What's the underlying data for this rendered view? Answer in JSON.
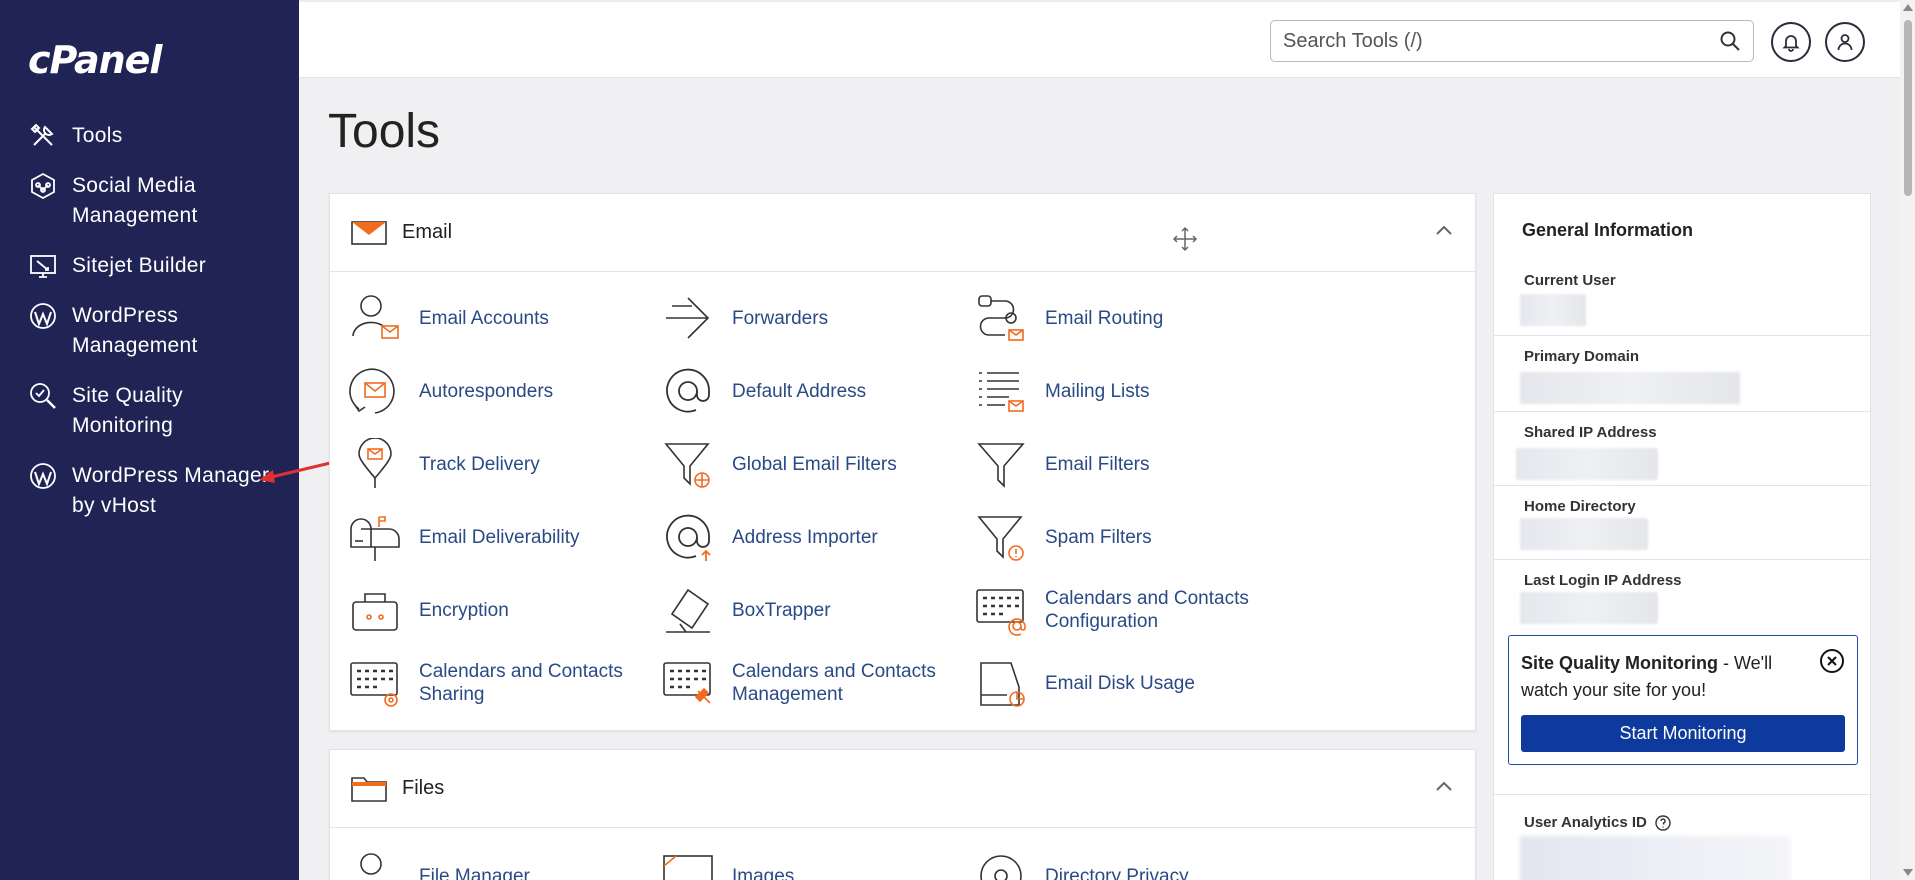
{
  "sidebar": {
    "logo": "cPanel",
    "items": [
      {
        "label": "Tools",
        "icon": "tools-icon"
      },
      {
        "label": "Social Media Management",
        "icon": "social-media-icon"
      },
      {
        "label": "Sitejet Builder",
        "icon": "sitejet-icon"
      },
      {
        "label": "WordPress Management",
        "icon": "wordpress-icon"
      },
      {
        "label": "Site Quality Monitoring",
        "icon": "site-quality-icon"
      },
      {
        "label": "WordPress Manager by vHost",
        "icon": "wordpress-icon"
      }
    ]
  },
  "topbar": {
    "search_placeholder": "Search Tools (/)"
  },
  "main": {
    "page_title": "Tools",
    "email": {
      "title": "Email",
      "tools": [
        {
          "label": "Email Accounts",
          "icon": "email-accounts-icon"
        },
        {
          "label": "Forwarders",
          "icon": "forwarders-icon"
        },
        {
          "label": "Email Routing",
          "icon": "email-routing-icon"
        },
        {
          "label": "Autoresponders",
          "icon": "autoresponders-icon"
        },
        {
          "label": "Default Address",
          "icon": "default-address-icon"
        },
        {
          "label": "Mailing Lists",
          "icon": "mailing-lists-icon"
        },
        {
          "label": "Track Delivery",
          "icon": "track-delivery-icon"
        },
        {
          "label": "Global Email Filters",
          "icon": "global-filters-icon"
        },
        {
          "label": "Email Filters",
          "icon": "email-filters-icon"
        },
        {
          "label": "Email Deliverability",
          "icon": "mailbox-icon"
        },
        {
          "label": "Address Importer",
          "icon": "address-importer-icon"
        },
        {
          "label": "Spam Filters",
          "icon": "spam-filters-icon"
        },
        {
          "label": "Encryption",
          "icon": "encryption-icon"
        },
        {
          "label": "BoxTrapper",
          "icon": "boxtrapper-icon"
        },
        {
          "label": "Calendars and Contacts Configuration",
          "icon": "calendar-config-icon"
        },
        {
          "label": "Calendars and Contacts Sharing",
          "icon": "calendar-sharing-icon"
        },
        {
          "label": "Calendars and Contacts Management",
          "icon": "calendar-management-icon"
        },
        {
          "label": "Email Disk Usage",
          "icon": "disk-usage-icon"
        }
      ]
    },
    "files": {
      "title": "Files",
      "tools": [
        {
          "label": "File Manager",
          "icon": "file-manager-icon"
        },
        {
          "label": "Images",
          "icon": "images-icon"
        },
        {
          "label": "Directory Privacy",
          "icon": "directory-privacy-icon"
        }
      ]
    }
  },
  "info": {
    "title": "General Information",
    "rows": [
      {
        "label": "Current User"
      },
      {
        "label": "Primary Domain"
      },
      {
        "label": "Shared IP Address"
      },
      {
        "label": "Home Directory"
      },
      {
        "label": "Last Login IP Address"
      }
    ],
    "sqm_title": "Site Quality Monitoring",
    "sqm_rest": " - We'll watch your site for you!",
    "sqm_button": "Start Monitoring",
    "user_analytics_label": "User Analytics ID"
  },
  "colors": {
    "sidebar_bg": "#1f2455",
    "link": "#2a4a86",
    "accent_orange": "#f26b21",
    "primary_button": "#0d3a9c"
  }
}
